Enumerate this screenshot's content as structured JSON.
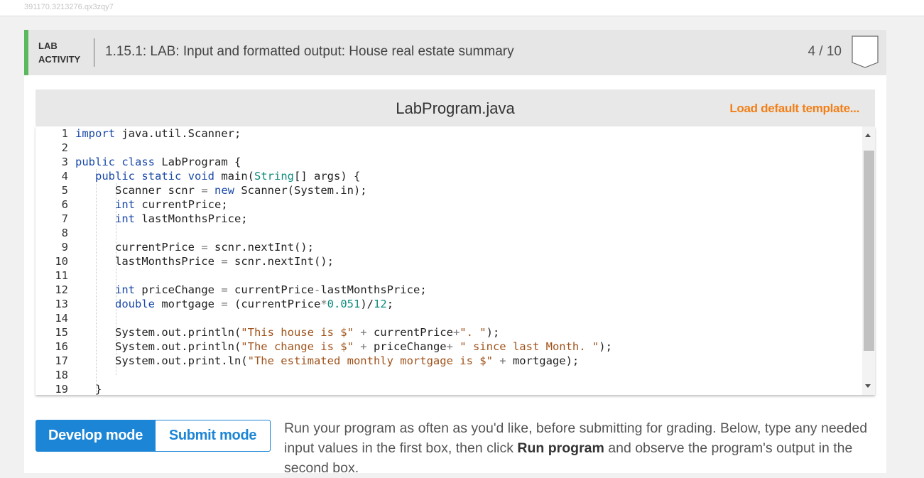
{
  "session_id": "391170.3213276.qx3zqy7",
  "lab": {
    "kind_line1": "LAB",
    "kind_line2": "ACTIVITY",
    "title": "1.15.1: LAB: Input and formatted output: House real estate summary",
    "score": "4 / 10",
    "accent_color": "#5cb85c"
  },
  "editor": {
    "filename": "LabProgram.java",
    "load_default": "Load default template...",
    "lines": [
      "import java.util.Scanner;",
      "",
      "public class LabProgram {",
      "   public static void main(String[] args) {",
      "      Scanner scnr = new Scanner(System.in);",
      "      int currentPrice;",
      "      int lastMonthsPrice;",
      "",
      "      currentPrice = scnr.nextInt();",
      "      lastMonthsPrice = scnr.nextInt();",
      "",
      "      int priceChange = currentPrice-lastMonthsPrice;",
      "      double mortgage = (currentPrice*0.051)/12;",
      "",
      "      System.out.println(\"This house is $\" + currentPrice+\". \");",
      "      System.out.println(\"The change is $\" + priceChange+ \" since last Month. \");",
      "      System.out.print.ln(\"The estimated monthly mortgage is $\" + mortgage);",
      "",
      "   }"
    ]
  },
  "modes": {
    "develop": "Develop mode",
    "submit": "Submit mode",
    "active_color": "#1c85d6"
  },
  "instructions": {
    "part1": "Run your program as often as you'd like, before submitting for grading. Below, type any needed input values in the first box, then click ",
    "run_label": "Run program",
    "part2": " and observe the program's output in the second box."
  },
  "icons": [
    "badge-shield-icon",
    "scroll-up-arrow-icon",
    "scroll-down-arrow-icon"
  ]
}
